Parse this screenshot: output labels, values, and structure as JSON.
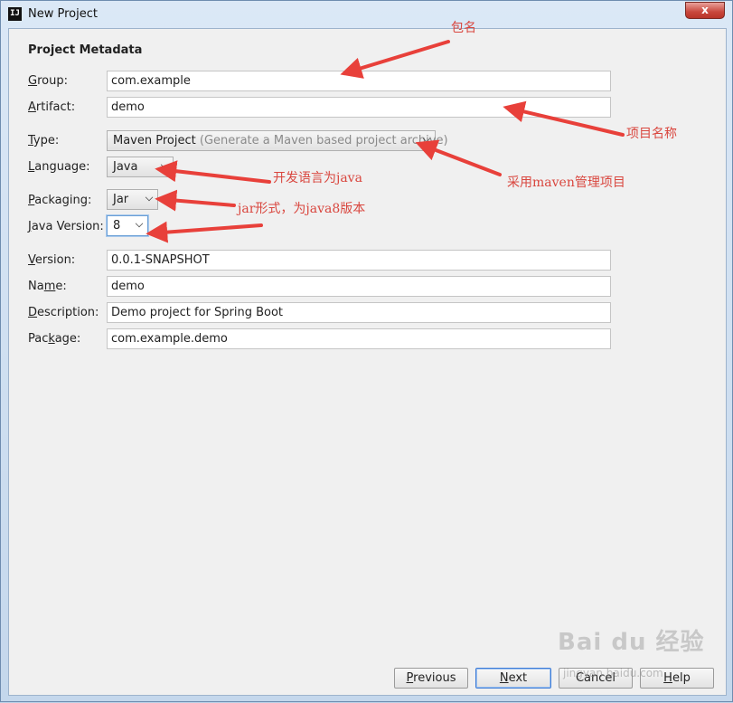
{
  "window": {
    "title": "New Project",
    "app_icon_text": "IJ",
    "close_label": "x"
  },
  "section_title": "Project Metadata",
  "fields": {
    "group": {
      "label_mn": "G",
      "label_rest": "roup:",
      "value": "com.example"
    },
    "artifact": {
      "label_mn": "A",
      "label_rest": "rtifact:",
      "value": "demo"
    },
    "type": {
      "label_mn": "T",
      "label_rest": "ype:",
      "value": "Maven Project",
      "hint": " (Generate a Maven based project archive)"
    },
    "language": {
      "label_mn": "L",
      "label_rest": "anguage:",
      "value": "Java"
    },
    "packaging": {
      "label_mn": "P",
      "label_rest": "ackaging:",
      "value": "Jar"
    },
    "java_version": {
      "label_mn": "J",
      "label_rest": "ava Version:",
      "value": "8"
    },
    "version": {
      "label_mn": "V",
      "label_rest": "ersion:",
      "value": "0.0.1-SNAPSHOT"
    },
    "name": {
      "label_pre": "Na",
      "label_mn": "m",
      "label_rest": "e:",
      "value": "demo"
    },
    "description": {
      "label_mn": "D",
      "label_rest": "escription:",
      "value": "Demo project for Spring Boot"
    },
    "package": {
      "label_pre": "Pac",
      "label_mn": "k",
      "label_rest": "age:",
      "value": "com.example.demo"
    }
  },
  "buttons": {
    "previous": {
      "mn": "P",
      "rest": "revious"
    },
    "next": {
      "mn": "N",
      "rest": "ext"
    },
    "cancel": {
      "label": "Cancel"
    },
    "help": {
      "mn": "H",
      "rest": "elp"
    }
  },
  "annotations": {
    "package_name": "包名",
    "project_name": "项目名称",
    "language_java": "开发语言为java",
    "maven": "采用maven管理项目",
    "jar_java8": "jar形式，为java8版本"
  },
  "watermark": {
    "logo": "Bai du 经验",
    "url": "jingyan.baidu.com"
  },
  "colors": {
    "annotation_red": "#d9463e",
    "arrow_red": "#e8403a"
  }
}
